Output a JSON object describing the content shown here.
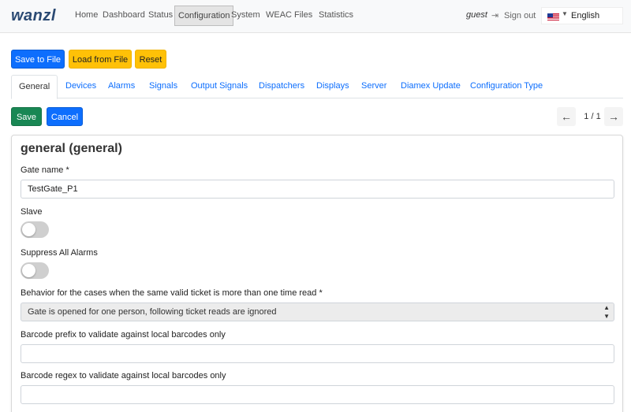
{
  "navbar": {
    "logo": "wanzl",
    "items": [
      {
        "label": "Home"
      },
      {
        "label": "Dashboard"
      },
      {
        "label": "Status"
      },
      {
        "label": "Configuration",
        "active": true
      },
      {
        "label": "System"
      },
      {
        "label": "WEAC"
      },
      {
        "label": "Files"
      },
      {
        "label": "Statistics"
      }
    ],
    "user": "guest",
    "sign_out": "Sign out",
    "language": "English"
  },
  "toolbar": {
    "save_to_file": "Save to File",
    "load_from_file": "Load from File",
    "reset": "Reset"
  },
  "tabs": [
    {
      "label": "General",
      "active": true
    },
    {
      "label": "Devices"
    },
    {
      "label": "Alarms"
    },
    {
      "label": "Signals"
    },
    {
      "label": "Output Signals"
    },
    {
      "label": "Dispatchers"
    },
    {
      "label": "Displays"
    },
    {
      "label": "Server"
    },
    {
      "label": "Diamex Update"
    },
    {
      "label": "Configuration Type"
    }
  ],
  "actions": {
    "save": "Save",
    "cancel": "Cancel"
  },
  "pager": {
    "text": "1 / 1"
  },
  "form": {
    "title": "general (general)",
    "gate_name": {
      "label": "Gate name *",
      "value": "TestGate_P1"
    },
    "slave": {
      "label": "Slave",
      "checked": false
    },
    "suppress_alarms": {
      "label": "Suppress All Alarms",
      "checked": false
    },
    "behavior": {
      "label": "Behavior for the cases when the same valid ticket is more than one time read *",
      "selected": "Gate is opened for one person, following ticket reads are ignored"
    },
    "barcode_prefix": {
      "label": "Barcode prefix to validate against local barcodes only",
      "value": ""
    },
    "barcode_regex": {
      "label": "Barcode regex to validate against local barcodes only",
      "value": ""
    }
  },
  "colors": {
    "primary": "#0d6efd",
    "warning": "#ffc107",
    "success": "#198754",
    "toggle_off": "#cfcfcf",
    "logo": "#2b4a73"
  }
}
